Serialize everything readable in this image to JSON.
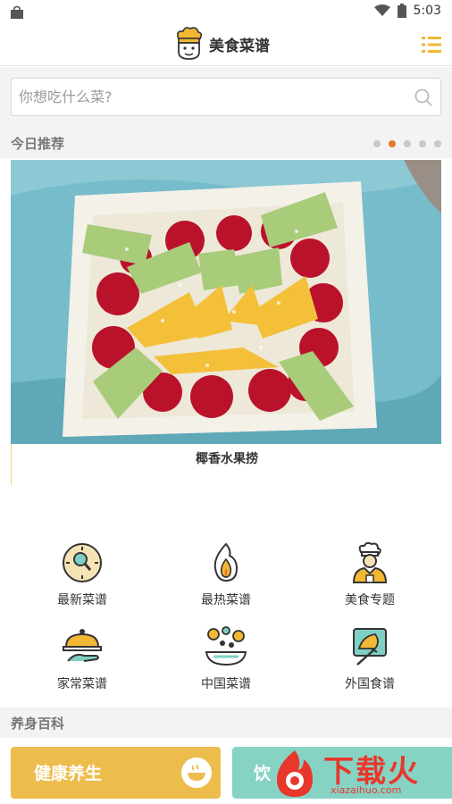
{
  "status_bar": {
    "time": "5:03"
  },
  "app_bar": {
    "title": "美食菜谱"
  },
  "search": {
    "placeholder": "你想吃什么菜?"
  },
  "recommend": {
    "heading": "今日推荐",
    "carousel_total": 5,
    "carousel_active_index": 1,
    "caption": "椰香水果捞"
  },
  "categories": [
    {
      "label": "最新菜谱",
      "icon": "clock-search-icon"
    },
    {
      "label": "最热菜谱",
      "icon": "flame-icon"
    },
    {
      "label": "美食专题",
      "icon": "chef-icon"
    },
    {
      "label": "家常菜谱",
      "icon": "serving-tray-icon"
    },
    {
      "label": "中国菜谱",
      "icon": "chinese-dishes-icon"
    },
    {
      "label": "外国食谱",
      "icon": "western-food-icon"
    }
  ],
  "health": {
    "heading": "养身百科",
    "card1": "健康养生",
    "card2": "饮"
  },
  "watermark": {
    "text": "下载火",
    "url": "xiazaihuo.com"
  },
  "colors": {
    "accent": "#ecbd4c",
    "dot_active": "#e8772e",
    "card2": "#86d3c4",
    "watermark": "#e8372b"
  }
}
